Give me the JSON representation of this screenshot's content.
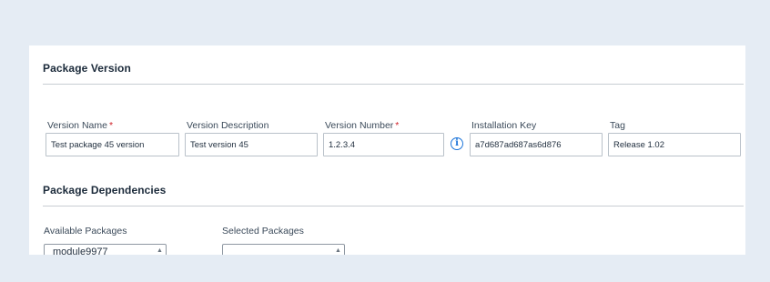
{
  "package_version": {
    "title": "Package Version",
    "fields": {
      "version_name": {
        "label": "Version Name",
        "required_mark": "*",
        "value": "Test package 45 version"
      },
      "version_description": {
        "label": "Version Description",
        "value": "Test version 45"
      },
      "version_number": {
        "label": "Version Number",
        "required_mark": "*",
        "value": "1.2.3.4"
      },
      "installation_key": {
        "label": "Installation Key",
        "value": "a7d687ad687as6d876",
        "info_icon": "info-icon"
      },
      "tag": {
        "label": "Tag",
        "value": "Release 1.02"
      }
    }
  },
  "package_dependencies": {
    "title": "Package Dependencies",
    "available": {
      "label": "Available Packages",
      "items": [
        "module9977"
      ]
    },
    "selected": {
      "label": "Selected Packages",
      "items": []
    }
  },
  "colors": {
    "page_bg": "#e5ecf4",
    "required": "#d0242b",
    "info": "#1a73d9"
  }
}
